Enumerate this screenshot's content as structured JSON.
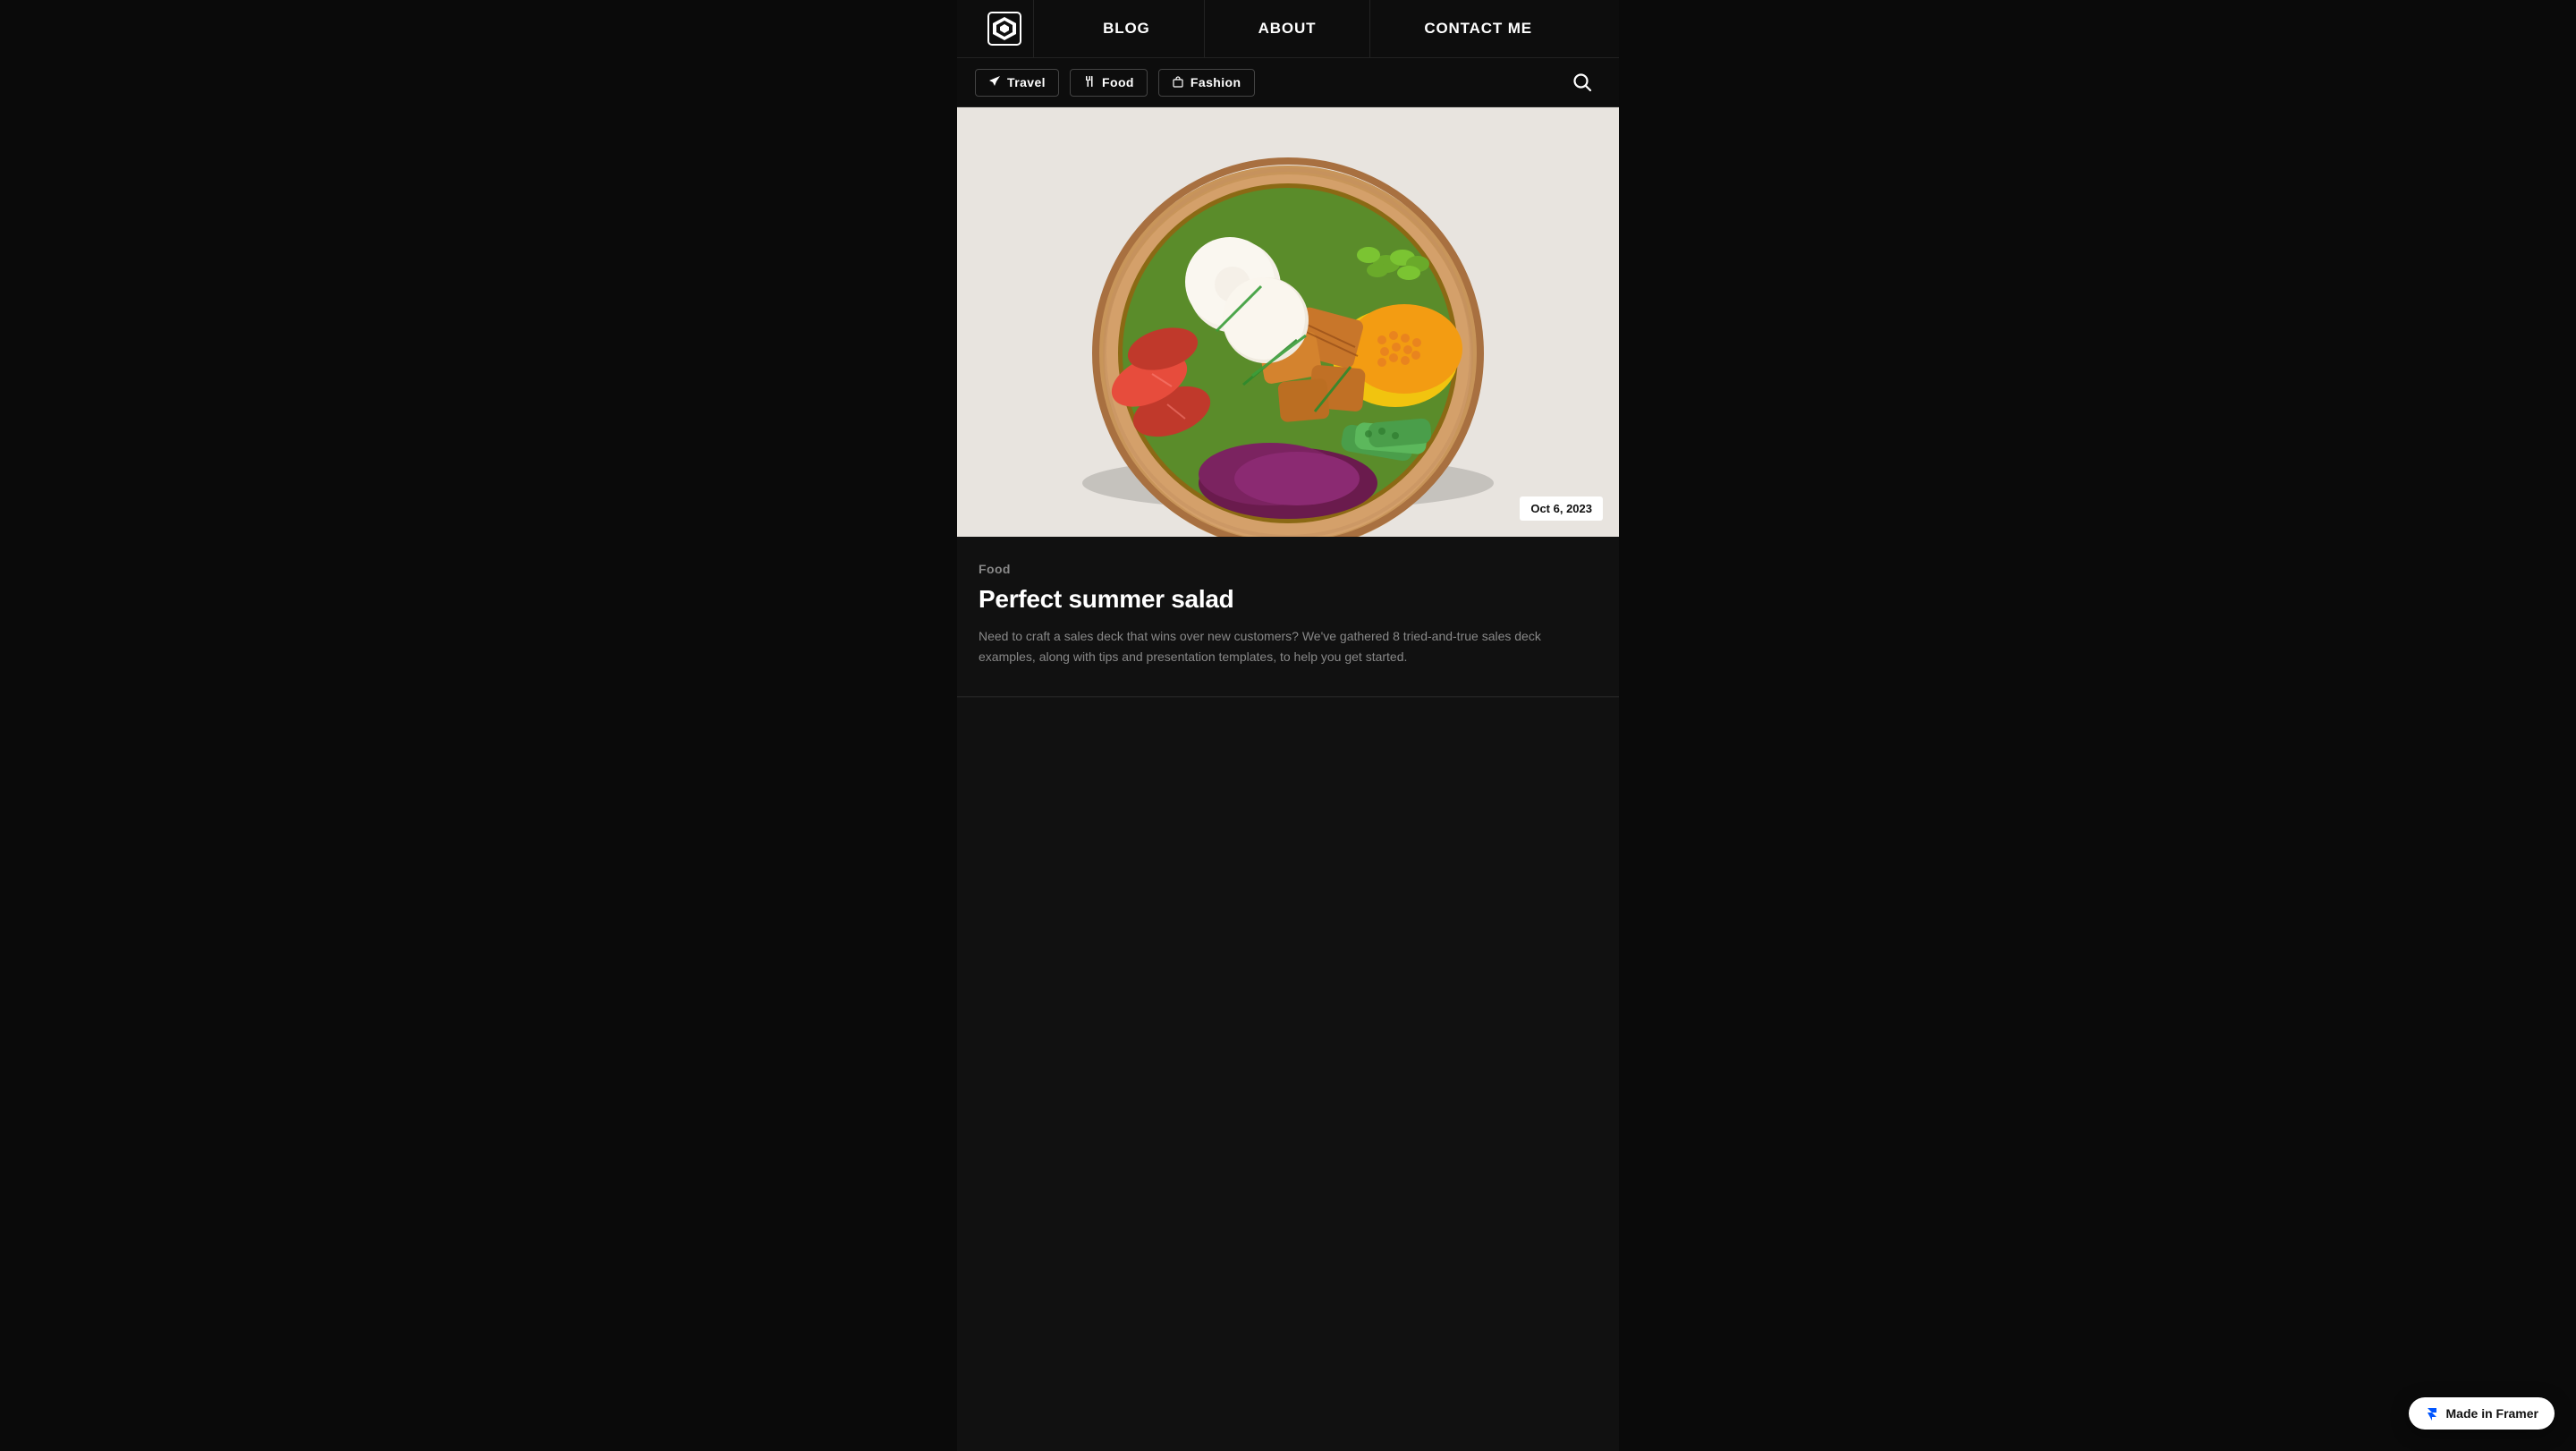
{
  "navbar": {
    "logo_alt": "Site Logo",
    "links": [
      {
        "label": "BLOG",
        "id": "blog"
      },
      {
        "label": "ABOUT",
        "id": "about"
      },
      {
        "label": "CONTACT ME",
        "id": "contact"
      }
    ]
  },
  "subnav": {
    "tags": [
      {
        "label": "Travel",
        "icon": "plane-icon",
        "id": "travel"
      },
      {
        "label": "Food",
        "icon": "fork-icon",
        "id": "food"
      },
      {
        "label": "Fashion",
        "icon": "bag-icon",
        "id": "fashion"
      }
    ],
    "search_label": "Search"
  },
  "hero": {
    "date": "Oct 6, 2023",
    "alt": "Food bowl with salad"
  },
  "article": {
    "category": "Food",
    "title": "Perfect summer salad",
    "excerpt": "Need to craft a sales deck that wins over new customers? We've gathered 8 tried-and-true sales deck examples, along with tips and presentation templates, to help you get started."
  },
  "framer_badge": {
    "label": "Made in Framer"
  }
}
